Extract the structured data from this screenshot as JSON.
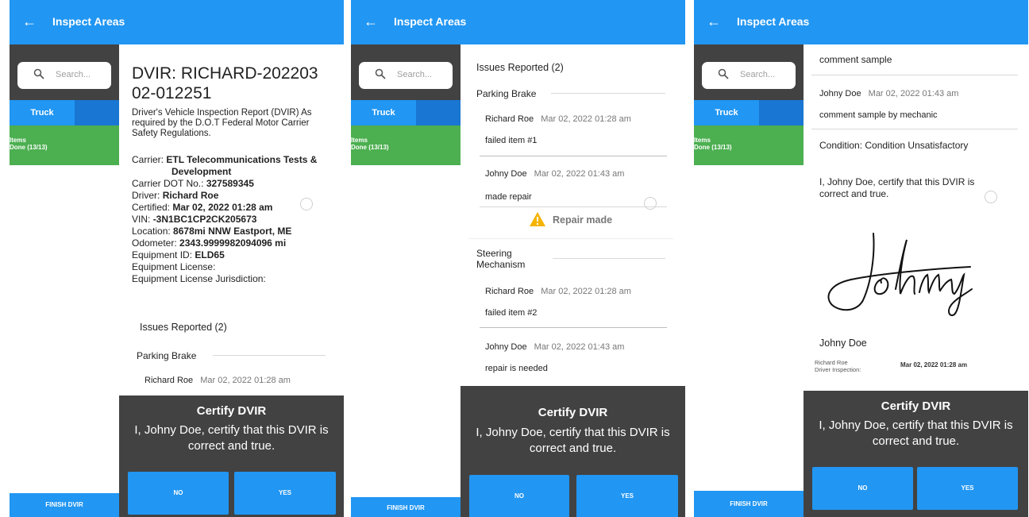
{
  "appbar": {
    "title": "Inspect Areas",
    "back_icon": "arrow-left-icon"
  },
  "sidebar": {
    "search_placeholder": "Search...",
    "tab_truck": "Truck",
    "items_line1": "Items",
    "items_line2": "Done (13/13)",
    "finish": "FINISH DVIR"
  },
  "certify": {
    "title": "Certify DVIR",
    "text_line1": "I, Johny Doe, certify that this DVIR is",
    "text_line2": "correct and true.",
    "no": "NO",
    "yes": "YES"
  },
  "screen1": {
    "title_line1": "DVIR: RICHARD-202203",
    "title_line2": "02-012251",
    "desc_line1": "Driver's Vehicle Inspection Report (DVIR) As",
    "desc_line2": "required by the D.O.T Federal Motor Carrier",
    "desc_line3": "Safety Regulations.",
    "carrier_label": "Carrier:",
    "carrier_value_1": "ETL Telecommunications Tests &",
    "carrier_value_2": "Development",
    "dot_label": "Carrier DOT No.:",
    "dot_value": "327589345",
    "driver_label": "Driver:",
    "driver_value": "Richard Roe",
    "certified_label": "Certified:",
    "certified_value": "Mar 02, 2022  01:28 am",
    "vin_label": "VIN:",
    "vin_value": "-3N1BC1CP2CK205673",
    "location_label": "Location:",
    "location_value": "8678mi NNW Eastport, ME",
    "odometer_label": "Odometer:",
    "odometer_value": "2343.9999982094096 mi",
    "equipment_id_label": "Equipment ID:",
    "equipment_id_value": "ELD65",
    "equipment_license": "Equipment License:",
    "equipment_jurisdiction": "Equipment License Jurisdiction:",
    "issues_header": "Issues Reported (2)",
    "parking_brake": "Parking Brake",
    "entry_name": "Richard Roe",
    "entry_date": "Mar 02, 2022  01:28 am"
  },
  "screen2": {
    "issues_header": "Issues Reported (2)",
    "parking_brake": "Parking Brake",
    "steering_line1": "Steering",
    "steering_line2": "Mechanism",
    "repair_made": "Repair made",
    "entries": [
      {
        "name": "Richard Roe",
        "date": "Mar 02, 2022  01:28 am",
        "comment": "failed item #1"
      },
      {
        "name": "Johny Doe",
        "date": "Mar 02, 2022  01:43 am",
        "comment": "made repair"
      },
      {
        "name": "Richard Roe",
        "date": "Mar 02, 2022  01:28 am",
        "comment": "failed item #2"
      },
      {
        "name": "Johny Doe",
        "date": "Mar 02, 2022  01:43 am",
        "comment": "repair is needed"
      }
    ]
  },
  "screen3": {
    "comment_sample": "comment sample",
    "mech_name": "Johny Doe",
    "mech_date": "Mar 02, 2022  01:43 am",
    "mech_comment": "comment sample by mechanic",
    "condition": "Condition: Condition Unsatisfactory",
    "cert_line1": "I, Johny Doe, certify that this DVIR is",
    "cert_line2": "correct and true.",
    "signer": "Johny Doe",
    "driver_name": "Richard Roe",
    "driver_inspection": "Driver Inspection:",
    "driver_date": "Mar 02, 2022  01:28 am"
  },
  "colors": {
    "primary": "#2196f3",
    "dark": "#424242",
    "green": "#4caf50",
    "warning": "#f5b400"
  }
}
